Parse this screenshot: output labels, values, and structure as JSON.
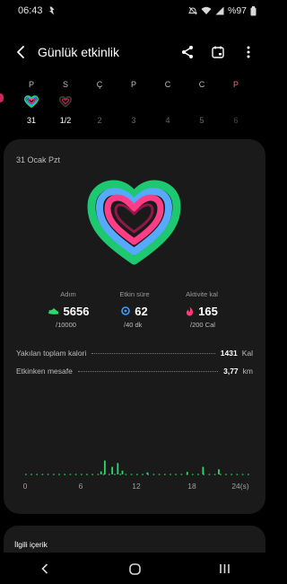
{
  "status_bar": {
    "time": "06:43",
    "battery": "%97"
  },
  "header": {
    "title": "Günlük etkinlik"
  },
  "days": [
    {
      "letter": "P",
      "number": "",
      "letter_color": "normal"
    },
    {
      "letter": "S",
      "number": "31",
      "selected": true
    },
    {
      "letter": "Ç",
      "number": "1/2",
      "current": true
    },
    {
      "letter": "P",
      "number": "2"
    },
    {
      "letter": "C",
      "number": "3"
    },
    {
      "letter": "C",
      "number": "4"
    },
    {
      "letter": "P",
      "number": "5",
      "letter_color": "red"
    },
    {
      "letter": "",
      "number": "6"
    }
  ],
  "day_strip": [
    {
      "letter": "P",
      "number": "31"
    },
    {
      "letter": "S",
      "number": "1/2"
    },
    {
      "letter": "Ç",
      "number": "2"
    },
    {
      "letter": "P",
      "number": "3"
    },
    {
      "letter": "C",
      "number": "4"
    },
    {
      "letter": "C",
      "number": "5"
    },
    {
      "letter": "P",
      "number": "6"
    }
  ],
  "card": {
    "date": "31 Ocak Pzt",
    "stats": [
      {
        "label": "Adım",
        "value": "5656",
        "goal": "/10000",
        "icon": "shoe-icon",
        "color": "#2bd96e"
      },
      {
        "label": "Etkin süre",
        "value": "62",
        "goal": "/40 dk",
        "icon": "timer-icon",
        "color": "#3aa0ff"
      },
      {
        "label": "Aktivite kal",
        "value": "165",
        "goal": "/200 Cal",
        "icon": "flame-icon",
        "color": "#ff3b7a"
      }
    ],
    "rows": [
      {
        "label": "Yakılan toplam kalori",
        "value": "1431",
        "unit": "Kal"
      },
      {
        "label": "Etkinken mesafe",
        "value": "3,77",
        "unit": "km"
      }
    ]
  },
  "chart_data": {
    "type": "bar",
    "x_ticks": [
      "0",
      "6",
      "12",
      "18",
      "24(s)"
    ],
    "xlim": [
      0,
      24
    ],
    "bars": [
      {
        "x": 8.2,
        "h": 0.12
      },
      {
        "x": 8.6,
        "h": 0.55
      },
      {
        "x": 9.4,
        "h": 0.3
      },
      {
        "x": 10.0,
        "h": 0.45
      },
      {
        "x": 10.5,
        "h": 0.15
      },
      {
        "x": 13.2,
        "h": 0.08
      },
      {
        "x": 17.5,
        "h": 0.1
      },
      {
        "x": 19.2,
        "h": 0.3
      },
      {
        "x": 20.9,
        "h": 0.2
      }
    ],
    "bar_color": "#2bd96e",
    "baseline_dots_color": "#2bd96e"
  },
  "related": {
    "title": "İlgili içerik"
  },
  "colors": {
    "steps": "#2bd96e",
    "active": "#3aa0ff",
    "calories": "#ff3b7a"
  }
}
